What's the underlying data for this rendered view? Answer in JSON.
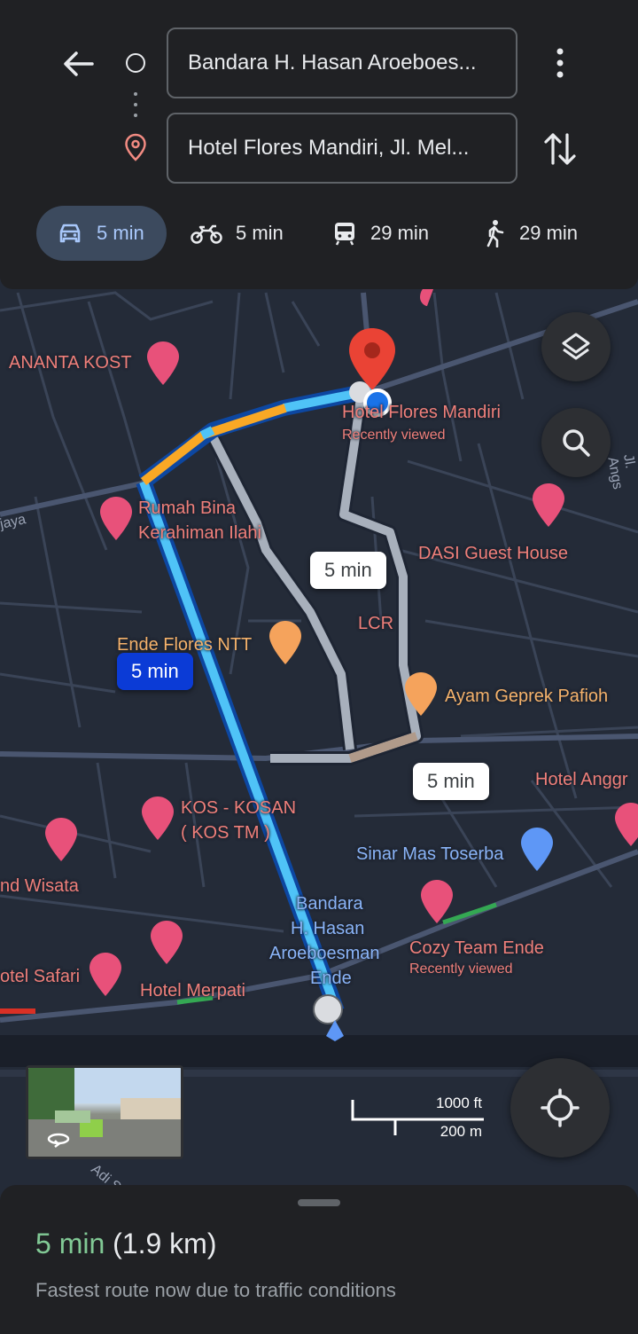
{
  "header": {
    "origin": "Bandara H. Hasan Aroeboes...",
    "destination": "Hotel Flores Mandiri, Jl. Mel...",
    "modes": [
      {
        "icon": "car-icon",
        "label": "5 min"
      },
      {
        "icon": "motorcycle-icon",
        "label": "5 min"
      },
      {
        "icon": "transit-icon",
        "label": "29 min"
      },
      {
        "icon": "walk-icon",
        "label": "29 min"
      }
    ]
  },
  "map": {
    "pois": {
      "ananta": "ANANTA KOST",
      "hotel_flores": "Hotel Flores Mandiri",
      "hotel_flores_sub": "Recently viewed",
      "rumah1": "Rumah Bina",
      "rumah2": "Kerahiman Ilahi",
      "dasi": "DASI Guest House",
      "lcr": "LCR",
      "ende": "Ende Flores NTT",
      "ayam": "Ayam Geprek Pafioh",
      "hotel_anggr": "Hotel Anggr",
      "kos1": "KOS - KOSAN",
      "kos2": "( KOS TM )",
      "sinar": "Sinar Mas Toserba",
      "wisata": "nd Wisata",
      "bandara1": "Bandara",
      "bandara2": "H. Hasan",
      "bandara3": "Aroeboesman",
      "bandara4": "Ende",
      "cozy": "Cozy Team Ende",
      "cozy_sub": "Recently viewed",
      "safari": "otel Safari",
      "merpati": "Hotel Merpati"
    },
    "roads": {
      "jaya": "jaya",
      "angs": "Jl. Angs",
      "adi": "Adi S"
    },
    "bubbles": {
      "selected": "5 min",
      "alt1": "5 min",
      "alt2": "5 min"
    },
    "scale": {
      "top": "1000 ft",
      "bottom": "200 m"
    }
  },
  "sheet": {
    "eta_time": "5 min",
    "eta_distance": "(1.9 km)",
    "note": "Fastest route now due to traffic conditions"
  }
}
